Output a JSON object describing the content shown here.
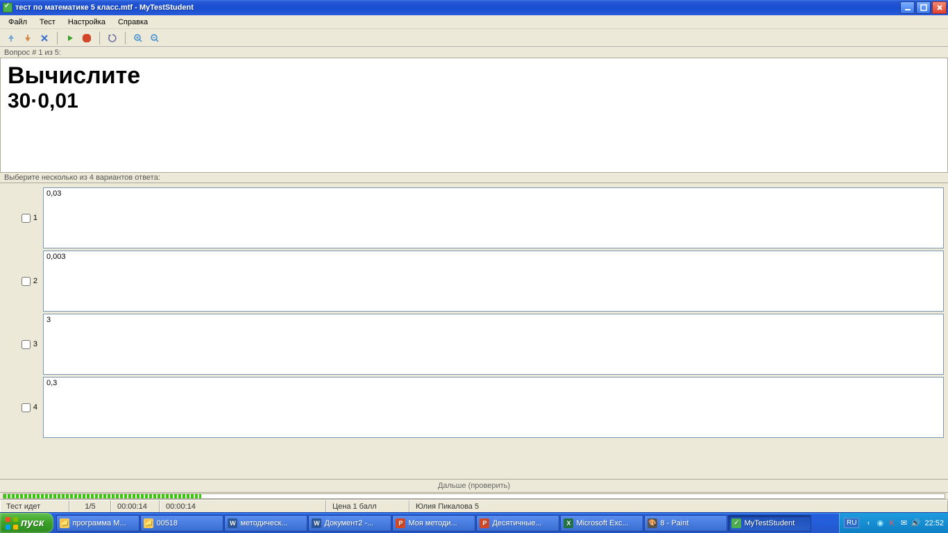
{
  "titlebar": {
    "title": "тест по математике 5 класс.mtf - MyTestStudent"
  },
  "menu": {
    "file": "Файл",
    "test": "Тест",
    "settings": "Настройка",
    "help": "Справка"
  },
  "question_strip": "Вопрос # 1 из 5:",
  "question": {
    "line1": "Вычислите",
    "line2": "30·0,01"
  },
  "instruction_strip": "Выберите несколько из 4 вариантов ответа:",
  "answers": [
    {
      "num": "1",
      "text": "0,03"
    },
    {
      "num": "2",
      "text": "0,003"
    },
    {
      "num": "3",
      "text": "3"
    },
    {
      "num": "4",
      "text": "0,3"
    }
  ],
  "next_label": "Дальше (проверить)",
  "status": {
    "running": "Тест идет",
    "progress": "1/5",
    "time1": "00:00:14",
    "time2": "00:00:14",
    "score": "Цена 1 балл",
    "user": "Юлия Пикалова 5"
  },
  "taskbar": {
    "start": "пуск",
    "items": [
      {
        "label": "программа М...",
        "icon": "📁",
        "color": "#f4c954"
      },
      {
        "label": "00518",
        "icon": "📁",
        "color": "#f4c954"
      },
      {
        "label": "методическ...",
        "icon": "W",
        "color": "#2b579a"
      },
      {
        "label": "Документ2 -...",
        "icon": "W",
        "color": "#2b579a"
      },
      {
        "label": "Моя методи...",
        "icon": "P",
        "color": "#d24726"
      },
      {
        "label": "Десятичные...",
        "icon": "P",
        "color": "#d24726"
      },
      {
        "label": "Microsoft Exc...",
        "icon": "X",
        "color": "#217346"
      },
      {
        "label": "8 - Paint",
        "icon": "🎨",
        "color": "#555"
      },
      {
        "label": "MyTestStudent",
        "icon": "✓",
        "color": "#4caf50",
        "active": true
      }
    ],
    "lang": "RU",
    "clock": "22:52"
  }
}
